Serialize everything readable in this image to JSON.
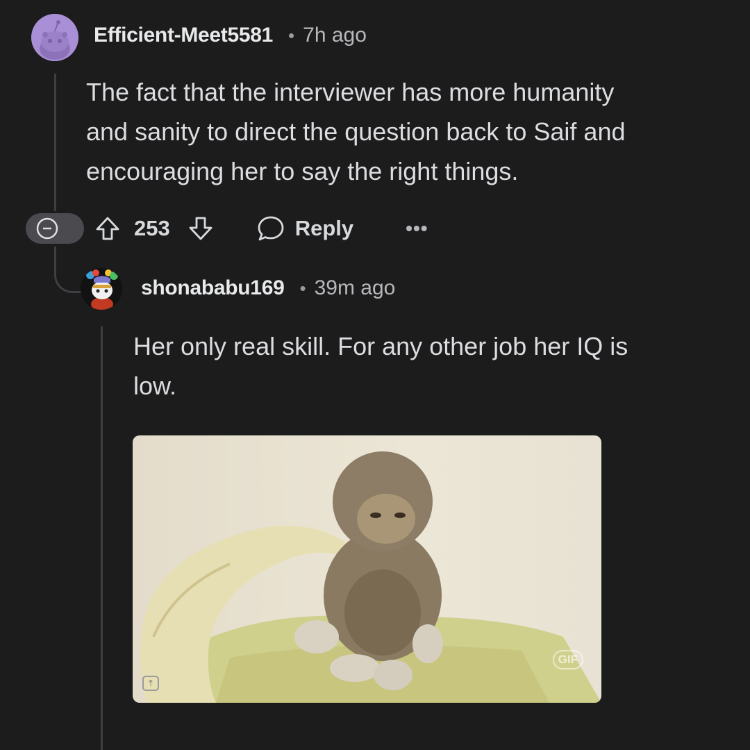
{
  "comments": [
    {
      "username": "Efficient-Meet5581",
      "separator": "•",
      "time": "7h ago",
      "body_lines": [
        "The fact that the interviewer has more humanity",
        "and sanity to direct the question back to Saif and",
        "encouraging her to say the right things."
      ],
      "score": "253",
      "reply_label": "Reply",
      "more_label": "•••"
    },
    {
      "username": "shonababu169",
      "separator": "•",
      "time": "39m ago",
      "body_lines": [
        "Her only real skill. For any other job her IQ is",
        "low."
      ],
      "gif_label": "GIF"
    }
  ],
  "colors": {
    "background": "#1c1c1d",
    "thread_line": "#3f3f43",
    "avatar_bg": "#a98fd6"
  },
  "icons": [
    "snoo-avatar-icon",
    "collapse-icon",
    "upvote-icon",
    "downvote-icon",
    "comment-bubble-icon",
    "more-options-icon",
    "gif-badge-icon"
  ]
}
